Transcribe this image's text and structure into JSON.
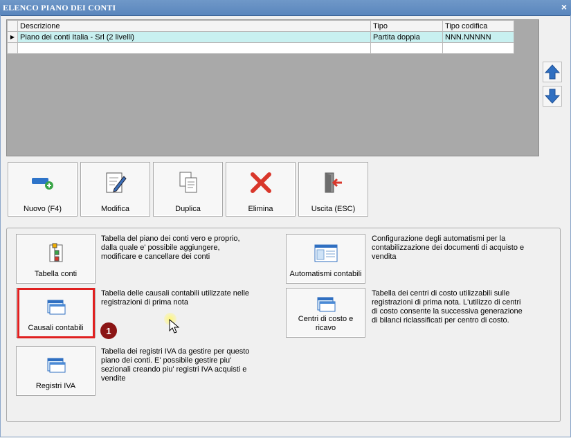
{
  "window": {
    "title": "ELENCO PIANO DEI CONTI",
    "close_glyph": "×"
  },
  "grid": {
    "columns": [
      "Descrizione",
      "Tipo",
      "Tipo codifica"
    ],
    "rows": [
      {
        "indicator": "▶",
        "descrizione": "Piano dei conti Italia - Srl (2 livelli)",
        "tipo": "Partita doppia",
        "tipo_codifica": "NNN.NNNNN"
      }
    ]
  },
  "side_arrows": {
    "up_icon": "arrow-up-icon",
    "down_icon": "arrow-down-icon",
    "color": "#2f6fc1"
  },
  "toolbar": {
    "nuovo": "Nuovo (F4)",
    "modifica": "Modifica",
    "duplica": "Duplica",
    "elimina": "Elimina",
    "uscita": "Uscita (ESC)"
  },
  "functions": {
    "tabella_conti": {
      "label": "Tabella conti",
      "desc_lines": [
        "Tabella del piano dei conti vero e proprio,",
        "dalla quale e' possibile aggiungere,",
        "modificare e cancellare dei conti"
      ]
    },
    "causali_contabili": {
      "label": "Causali contabili",
      "desc_lines": [
        "Tabella delle causali contabili utilizzate nelle",
        "registrazioni di prima nota"
      ]
    },
    "registri_iva": {
      "label": "Registri IVA",
      "desc_lines": [
        "Tabella dei registri IVA da gestire per questo",
        "piano dei conti. E' possibile gestire piu'",
        "sezionali creando piu' registri IVA acquisti e",
        "vendite"
      ]
    },
    "automatismi": {
      "label": "Automatismi contabili",
      "desc_lines": [
        "Configurazione degli automatismi per la",
        "contabilizzazione dei documenti di acquisto e",
        "vendita"
      ]
    },
    "centri_costo": {
      "label_lines": [
        "Centri di costo e",
        "ricavo"
      ],
      "desc_lines": [
        "Tabella dei centri di costo utilizzabili sulle",
        "registrazioni di prima nota. L'utilizzo di centri",
        "di costo consente la successiva generazione",
        "di bilanci riclassificati per centro di costo."
      ]
    }
  },
  "annotation": {
    "badge": "1",
    "highlight_color": "#e02020",
    "badge_color": "#8b1515"
  }
}
